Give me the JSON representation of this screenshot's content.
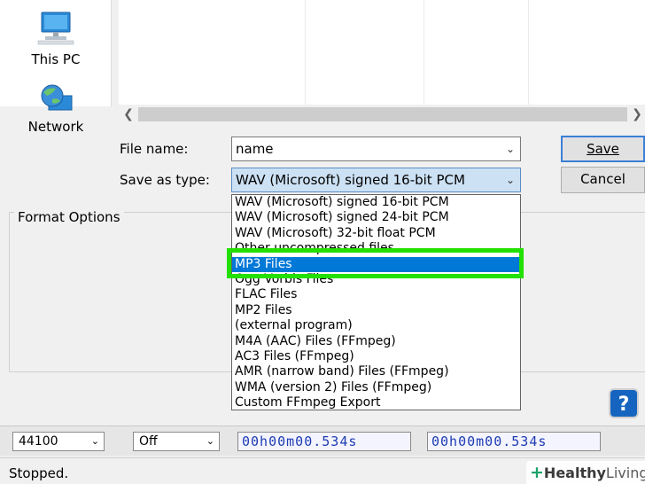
{
  "nav": {
    "this_pc": "This PC",
    "network": "Network"
  },
  "file_name": {
    "label": "File name:",
    "value": "name"
  },
  "save_as_type": {
    "label": "Save as type:",
    "value": "WAV (Microsoft) signed 16-bit PCM",
    "options": [
      "WAV (Microsoft) signed 16-bit PCM",
      "WAV (Microsoft) signed 24-bit PCM",
      "WAV (Microsoft) 32-bit float PCM",
      "Other uncompressed files",
      "MP3 Files",
      "Ogg Vorbis Files",
      "FLAC Files",
      "MP2 Files",
      "(external program)",
      "M4A (AAC) Files (FFmpeg)",
      "AC3 Files (FFmpeg)",
      "AMR (narrow band) Files (FFmpeg)",
      "WMA (version 2) Files (FFmpeg)",
      "Custom FFmpeg Export"
    ],
    "selected": "MP3 Files"
  },
  "buttons": {
    "save": "Save",
    "cancel": "Cancel",
    "help": "?"
  },
  "format_options": {
    "title": "Format Options"
  },
  "bottom_toolbar": {
    "project_rate": "44100",
    "snap_to": "Off",
    "selection_start": "00h00m00.534s",
    "selection_end": "00h00m00.534s"
  },
  "status": {
    "text": "Stopped."
  },
  "watermark": {
    "brand_bold": "Healthy",
    "brand_light": "Living"
  },
  "colors": {
    "highlight": "#22e000",
    "selection": "#0078d7"
  }
}
